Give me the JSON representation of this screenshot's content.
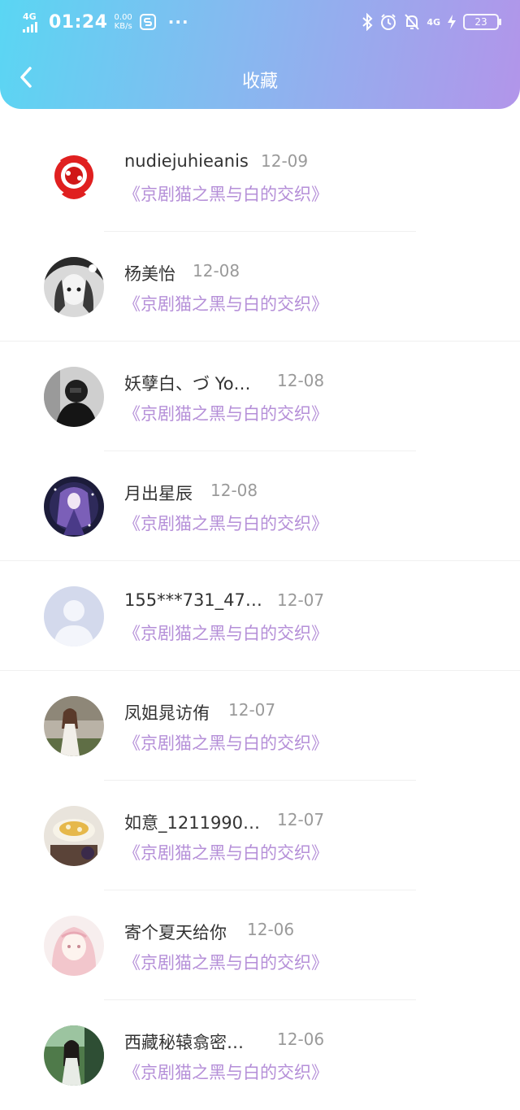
{
  "status_bar": {
    "network": "4G",
    "time": "01:24",
    "speed_value": "0.00",
    "speed_unit": "KB/s",
    "network_right": "4G",
    "battery": "23"
  },
  "header": {
    "title": "收藏"
  },
  "items": [
    {
      "name": "nudiejuhieanis",
      "date": "12-09",
      "book": "《京剧猫之黑与白的交织》"
    },
    {
      "name": "杨美怡",
      "date": "12-08",
      "book": "《京剧猫之黑与白的交织》"
    },
    {
      "name": "妖孽白、づ Yo…",
      "date": "12-08",
      "book": "《京剧猫之黑与白的交织》"
    },
    {
      "name": "月出星辰",
      "date": "12-08",
      "book": "《京剧猫之黑与白的交织》"
    },
    {
      "name": "155***731_47…",
      "date": "12-07",
      "book": "《京剧猫之黑与白的交织》"
    },
    {
      "name": "凤姐晁访侑",
      "date": "12-07",
      "book": "《京剧猫之黑与白的交织》"
    },
    {
      "name": "如意_1211990…",
      "date": "12-07",
      "book": "《京剧猫之黑与白的交织》"
    },
    {
      "name": "寄个夏天给你",
      "date": "12-06",
      "book": "《京剧猫之黑与白的交织》"
    },
    {
      "name": "西藏秘辕翕密…",
      "date": "12-06",
      "book": "《京剧猫之黑与白的交织》"
    }
  ]
}
